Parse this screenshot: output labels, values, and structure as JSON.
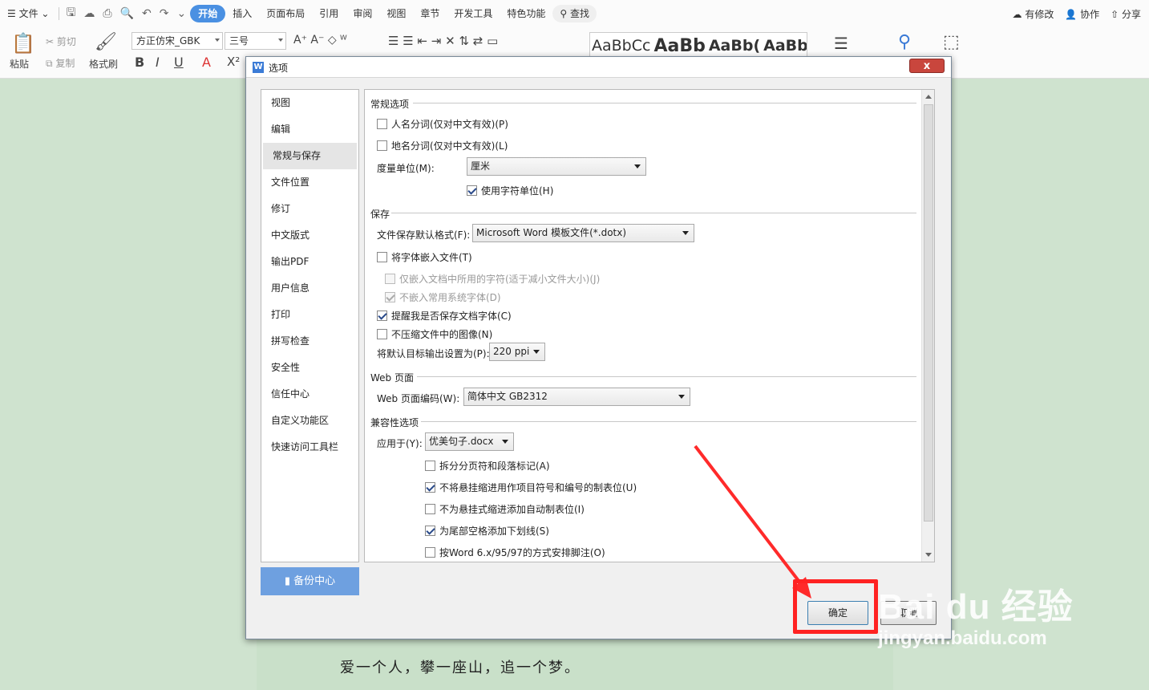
{
  "menubar": {
    "file": "文件",
    "tabs": [
      "开始",
      "插入",
      "页面布局",
      "引用",
      "审阅",
      "视图",
      "章节",
      "开发工具",
      "特色功能"
    ],
    "search": "查找",
    "modified": "有修改",
    "collab": "协作",
    "share": "分享"
  },
  "ribbon": {
    "paste": "粘贴",
    "cut": "剪切",
    "copy": "复制",
    "format_painter": "格式刷",
    "font_name": "方正仿宋_GBK",
    "font_size": "三号",
    "styles": [
      "AaBbCc",
      "AaBb",
      "AaBb(",
      "AaBbC"
    ]
  },
  "document": {
    "line": "爱一个人，攀一座山，追一个梦。"
  },
  "dialog": {
    "title": "选项",
    "close": "x",
    "nav": [
      "视图",
      "编辑",
      "常规与保存",
      "文件位置",
      "修订",
      "中文版式",
      "输出PDF",
      "用户信息",
      "打印",
      "拼写检查",
      "安全性",
      "信任中心",
      "自定义功能区",
      "快速访问工具栏"
    ],
    "nav_selected": "常规与保存",
    "backup": "备份中心",
    "general": {
      "header": "常规选项",
      "name_split": "人名分词(仅对中文有效)(P)",
      "place_split": "地名分词(仅对中文有效)(L)",
      "unit_label": "度量单位(M):",
      "unit_value": "厘米",
      "char_unit": "使用字符单位(H)"
    },
    "save": {
      "header": "保存",
      "format_label": "文件保存默认格式(F):",
      "format_value": "Microsoft Word 模板文件(*.dotx)",
      "embed_fonts": "将字体嵌入文件(T)",
      "embed_used": "仅嵌入文档中所用的字符(适于减小文件大小)(J)",
      "no_common": "不嵌入常用系统字体(D)",
      "remind": "提醒我是否保存文档字体(C)",
      "no_compress": "不压缩文件中的图像(N)",
      "ppi_label": "将默认目标输出设置为(P):",
      "ppi_value": "220 ppi"
    },
    "web": {
      "header": "Web 页面",
      "encoding_label": "Web 页面编码(W):",
      "encoding_value": "简体中文 GB2312"
    },
    "compat": {
      "header": "兼容性选项",
      "apply_label": "应用于(Y):",
      "apply_value": "优美句子.docx",
      "opt1": "拆分分页符和段落标记(A)",
      "opt2": "不将悬挂缩进用作项目符号和编号的制表位(U)",
      "opt3": "不为悬挂式缩进添加自动制表位(I)",
      "opt4": "为尾部空格添加下划线(S)",
      "opt5": "按Word 6.x/95/97的方式安排脚注(O)"
    },
    "ok": "确定",
    "cancel": "取消"
  },
  "watermark": {
    "brand": "Bai du 经验",
    "url": "jingyan.baidu.com"
  },
  "colors": {
    "accent": "#4a90e2",
    "highlight": "#ff2222",
    "doc_bg": "#cfe3cf"
  }
}
